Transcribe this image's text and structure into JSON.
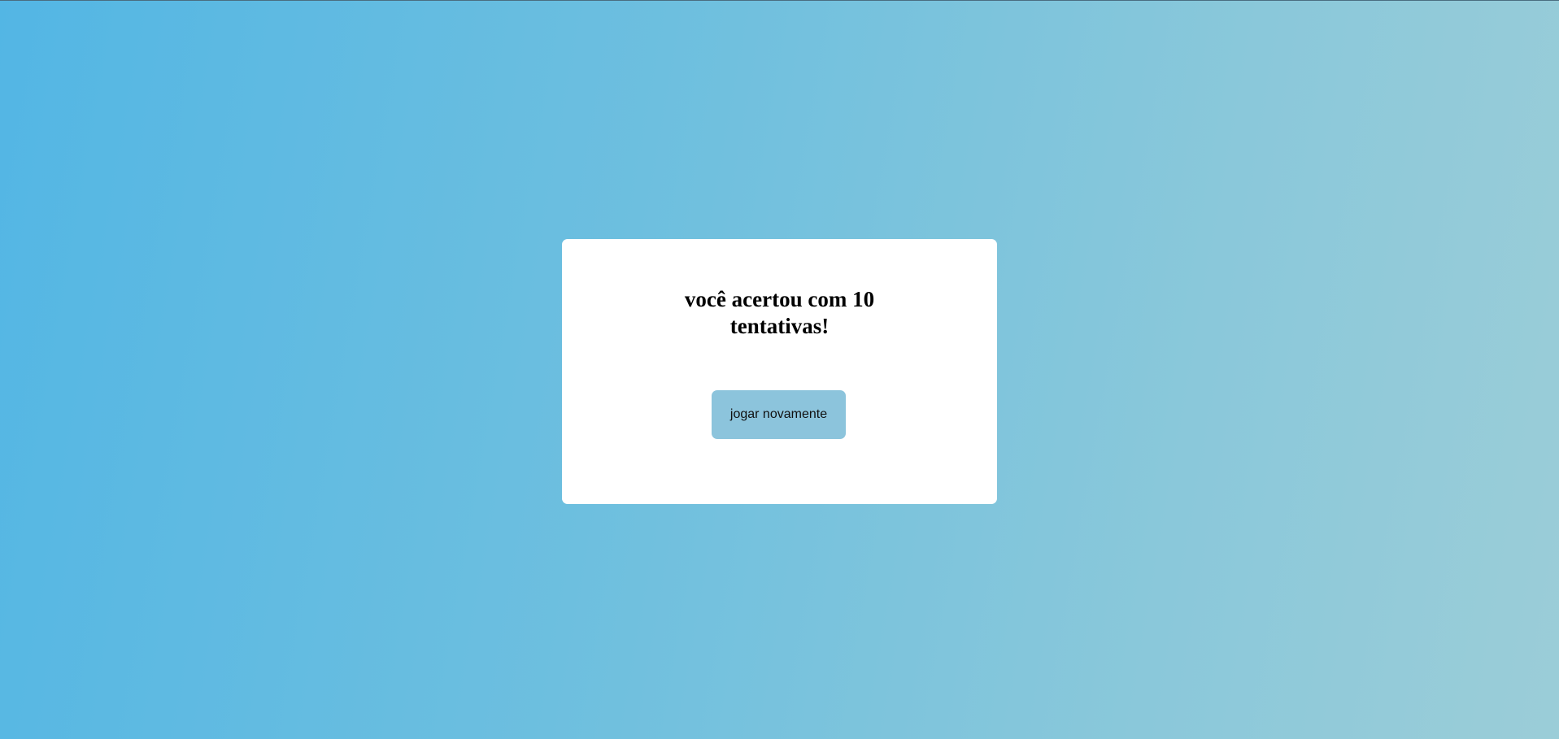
{
  "game": {
    "result_message": "você acertou com 10 tentativas!",
    "play_again_label": "jogar novamente"
  },
  "colors": {
    "background_start": "#53b6e4",
    "background_end": "#9bcdd8",
    "card": "#ffffff",
    "button": "#8cc4dc"
  }
}
